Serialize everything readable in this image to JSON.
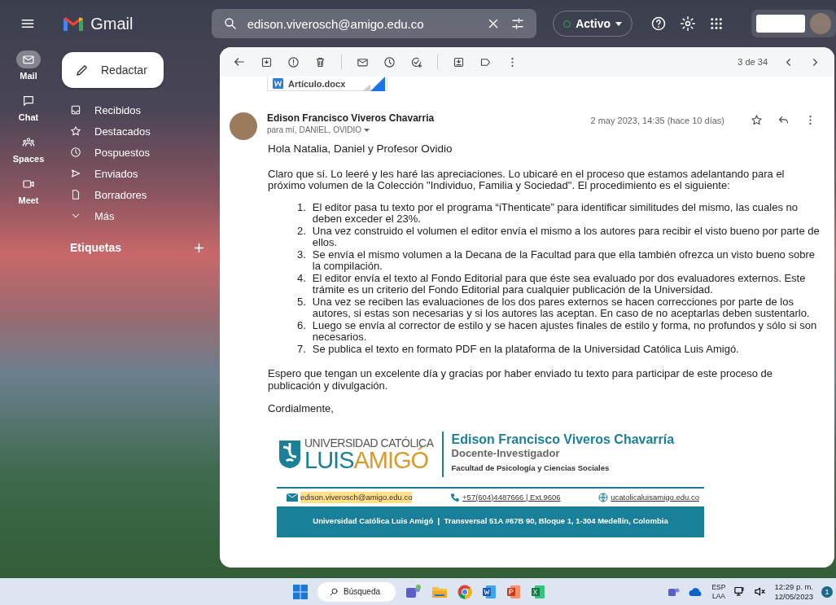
{
  "top_bar": {
    "app_name": "Gmail",
    "search": {
      "value": "edison.viverosch@amigo.edu.co"
    },
    "status": "Activo"
  },
  "rail": [
    {
      "label": "Mail",
      "kind": "mail",
      "selected": true
    },
    {
      "label": "Chat",
      "kind": "chat",
      "selected": false
    },
    {
      "label": "Spaces",
      "kind": "spaces",
      "selected": false
    },
    {
      "label": "Meet",
      "kind": "meet",
      "selected": false
    }
  ],
  "compose": "Redactar",
  "nav": [
    {
      "label": "Recibidos",
      "kind": "inbox",
      "selected": false
    },
    {
      "label": "Destacados",
      "kind": "star",
      "selected": false
    },
    {
      "label": "Pospuestos",
      "kind": "clock",
      "selected": false
    },
    {
      "label": "Enviados",
      "kind": "send",
      "selected": false
    },
    {
      "label": "Borradores",
      "kind": "draft",
      "selected": false
    },
    {
      "label": "Más",
      "kind": "more",
      "selected": false
    }
  ],
  "labels_heading": "Etiquetas",
  "toolbar": {
    "pager": "3 de 34"
  },
  "attachment": {
    "name": "Artículo.docx"
  },
  "message": {
    "sender": "Edison Francisco Viveros Chavarria",
    "recipients": "para mí, DANIEL, OVIDIO",
    "date": "2 may 2023, 14:35 (hace 10 días)",
    "greeting": "Hola Natalia, Daniel y Profesor Ovidio",
    "intro": "Claro que sí. Lo leeré y les haré las apreciaciones. Lo ubicaré en el proceso que estamos adelantando para el próximo volumen de la Colección \"Individuo, Familia y Sociedad\". El procedimiento es el siguiente:",
    "steps": [
      {
        "number": "1.",
        "text": "El editor pasa tu texto por el programa “iThenticate” para identificar similitudes del mismo, las cuales no deben exceder el 23%."
      },
      {
        "number": "2.",
        "text": "Una vez construido el volumen el editor envía el mismo a los autores para recibir el visto bueno por parte de ellos."
      },
      {
        "number": "3.",
        "text": "Se envía el mismo volumen a la Decana de la Facultad para que ella también ofrezca un visto bueno sobre la compilación."
      },
      {
        "number": "4.",
        "text": "El editor envía el texto al Fondo Editorial para que éste sea evaluado por dos evaluadores externos. Este trámite es un criterio del Fondo Editorial para cualquier publicación de la Universidad."
      },
      {
        "number": "5.",
        "text": "Una vez se reciben las evaluaciones de los dos pares externos se hacen correcciones por parte de los autores, si estas son necesarias y si los autores las aceptan. En caso de no aceptarlas deben sustentarlo."
      },
      {
        "number": "6.",
        "text": "Luego se envía al corrector de estilo y se hacen ajustes finales de estilo y forma, no profundos y sólo si son necesarios."
      },
      {
        "number": "7.",
        "text": "Se publica el texto en formato PDF en la plataforma de la Universidad Católica Luis Amigó."
      }
    ],
    "closing": "Espero que tengan un excelente día y gracias por haber enviado tu texto para participar de este proceso de publicación y divulgación.",
    "signoff": "Cordialmente,"
  },
  "signature": {
    "logo_top": "UNIVERSIDAD CATÓLICA",
    "logo_left": "LUIS",
    "logo_right": "AMIGÓ",
    "name": "Edison Francisco Viveros Chavarría",
    "role": "Docente-Investigador",
    "faculty": "Facultad de Psicología y Ciencias Sociales",
    "email": "edison.viverosch@amigo.edu.co",
    "phone": "+57(604)4487666 | Ext.9606",
    "website": "ucatolicaluisamigo.edu.co",
    "footer": "Universidad Católica Luis Amigó  |  Transversal 51A #67B 90, Bloque 1, 1-304 Medellín, Colombia"
  },
  "taskbar": {
    "search": "Búsqueda",
    "language": "ESP",
    "region": "LAA",
    "time": "12:29 p. m.",
    "date": "12/05/2023",
    "notifications": "1"
  }
}
